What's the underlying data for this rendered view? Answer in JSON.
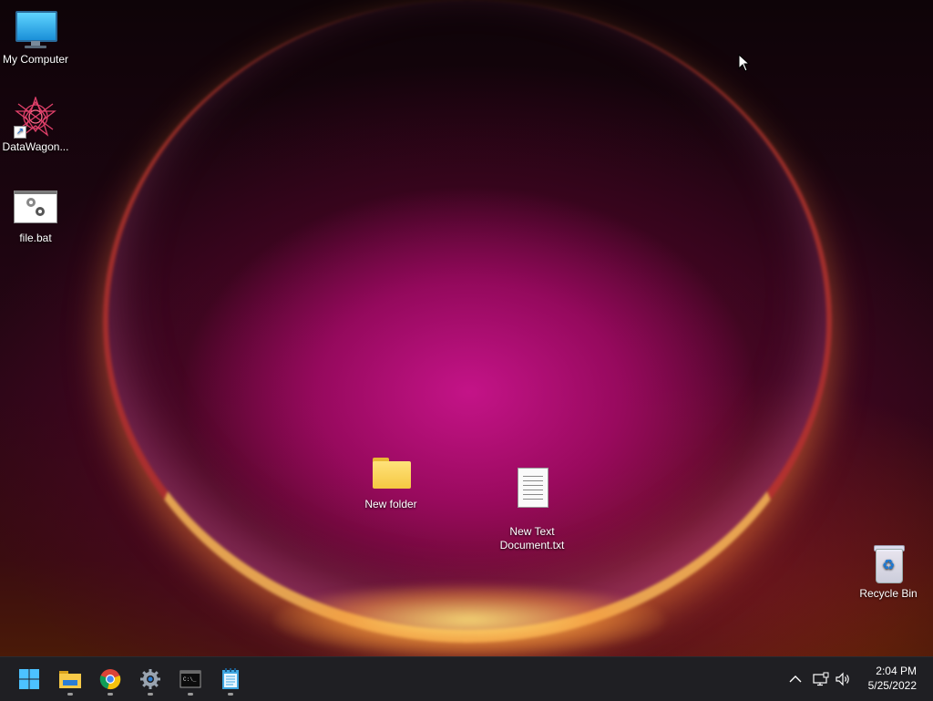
{
  "desktop": {
    "icons": [
      {
        "label": "My Computer",
        "icon": "monitor-icon"
      },
      {
        "label": "DataWagon...",
        "icon": "datawagon-icon"
      },
      {
        "label": "file.bat",
        "icon": "batch-file-icon"
      },
      {
        "label": "New folder",
        "icon": "folder-icon"
      },
      {
        "label": "New Text\nDocument.txt",
        "icon": "text-document-icon"
      },
      {
        "label": "Recycle Bin",
        "icon": "recycle-bin-icon"
      }
    ]
  },
  "taskbar": {
    "apps": [
      {
        "name": "Start",
        "icon": "windows-start-icon"
      },
      {
        "name": "File Explorer",
        "icon": "file-explorer-icon"
      },
      {
        "name": "Google Chrome",
        "icon": "chrome-icon"
      },
      {
        "name": "Settings",
        "icon": "settings-gear-icon"
      },
      {
        "name": "Terminal",
        "icon": "terminal-icon"
      },
      {
        "name": "Notepad",
        "icon": "notepad-icon"
      }
    ],
    "tray": {
      "chevron_icon": "chevron-up-icon",
      "network_icon": "network-icon",
      "volume_icon": "volume-icon"
    },
    "clock": {
      "time": "2:04 PM",
      "date": "5/25/2022"
    }
  },
  "colors": {
    "taskbar_bg": "#1f1f23",
    "accent_blue": "#1a8fd8"
  }
}
